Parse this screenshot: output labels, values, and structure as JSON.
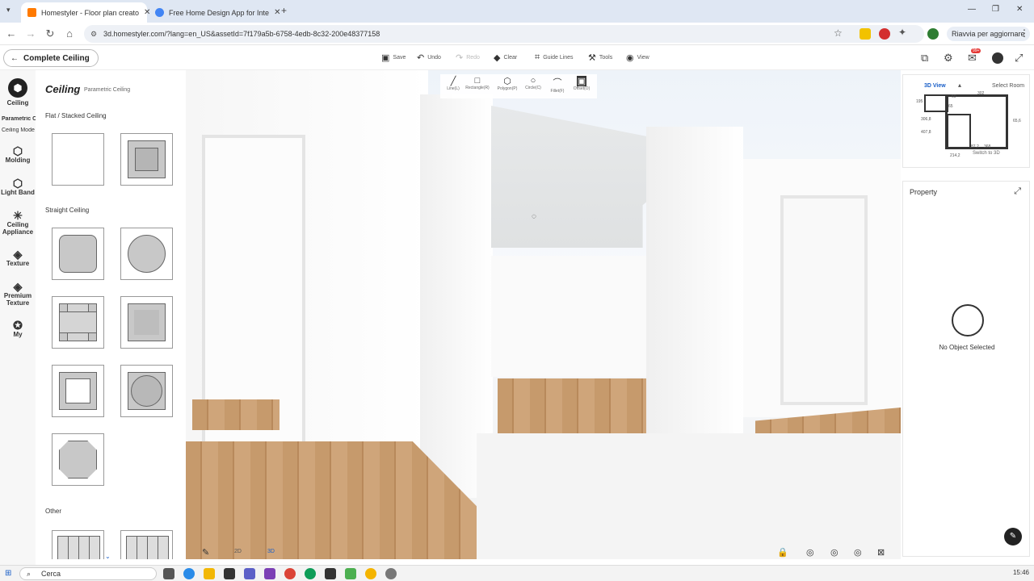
{
  "browser": {
    "tabs": [
      {
        "title": "Homestyler - Floor plan creato",
        "active": true
      },
      {
        "title": "Free Home Design App for Inte",
        "active": false
      }
    ],
    "url": "3d.homestyler.com/?lang=en_US&assetId=7f179a5b-6758-4edb-8c32-200e48377158",
    "relaunch_label": "Riavvia per aggiornare"
  },
  "toolbar": {
    "complete_label": "Complete Ceiling",
    "save": "Save",
    "undo": "Undo",
    "redo": "Redo",
    "clear": "Clear",
    "guide_lines": "Guide Lines",
    "tools": "Tools",
    "view": "View",
    "badge": "99+"
  },
  "rail": {
    "items": [
      {
        "label": "Ceiling",
        "icon": "ceiling-icon"
      },
      {
        "label": "Molding",
        "icon": "molding-icon"
      },
      {
        "label": "Light Band",
        "icon": "light-band-icon"
      },
      {
        "label": "Ceiling Appliance",
        "icon": "ceiling-appliance-icon"
      },
      {
        "label": "Texture",
        "icon": "texture-icon"
      },
      {
        "label": "Premium Texture",
        "icon": "premium-texture-icon"
      },
      {
        "label": "My",
        "icon": "my-icon"
      }
    ],
    "sub1": "Parametric C",
    "sub2": "Ceiling Mode"
  },
  "panel": {
    "title": "Ceiling",
    "subtitle": "Parametric Ceiling",
    "sections": [
      "Flat / Stacked Ceiling",
      "Straight Ceiling",
      "Other"
    ]
  },
  "drawtools": [
    {
      "label": "Line(L)",
      "icon": "line-icon"
    },
    {
      "label": "Rectangle(R)",
      "icon": "rectangle-icon"
    },
    {
      "label": "Polygon(P)",
      "icon": "polygon-icon"
    },
    {
      "label": "Circle(C)",
      "icon": "circle-icon"
    },
    {
      "label": "Fillet(F)",
      "icon": "fillet-icon"
    },
    {
      "label": "Offset(O)",
      "icon": "offset-icon"
    }
  ],
  "minimap": {
    "tab_3d": "3D View",
    "tab_select": "Select Room",
    "switch_label": "Switch to 3D",
    "dims": [
      "195",
      "60",
      "302",
      "65",
      "306,8",
      "407,8",
      "65,6",
      "214,2",
      "87,2",
      "368"
    ]
  },
  "property": {
    "title": "Property",
    "empty": "No Object Selected"
  },
  "bottombar": {
    "mode_2d": "2D",
    "mode_3d": "3D"
  },
  "taskbar": {
    "search": "Cerca",
    "clock": "15:46"
  },
  "colors": {
    "accent": "#1a5fc8",
    "wood": "#c69a6c",
    "badge": "#e53935"
  }
}
